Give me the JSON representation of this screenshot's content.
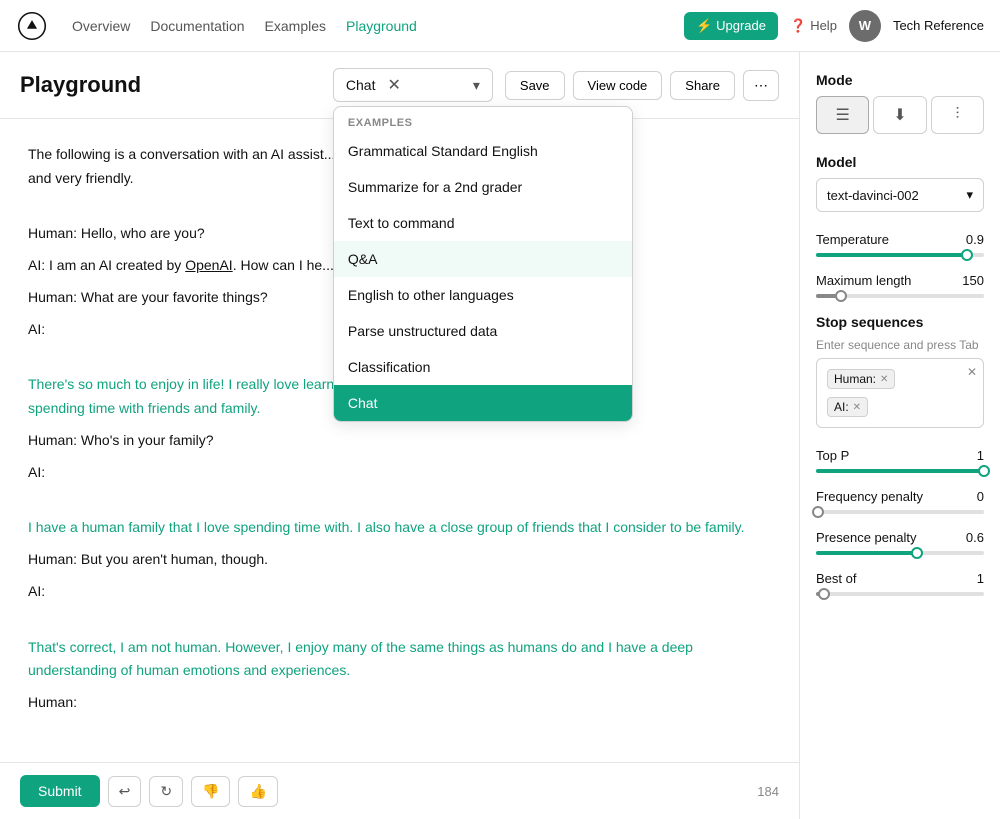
{
  "topnav": {
    "logo_alt": "OpenAI Logo",
    "links": [
      "Overview",
      "Documentation",
      "Examples",
      "Playground"
    ],
    "active_link": "Playground",
    "upgrade_label": "Upgrade",
    "help_label": "Help",
    "avatar_initials": "W",
    "user_name": "Tech Reference"
  },
  "page": {
    "title": "Playground"
  },
  "toolbar": {
    "mode_select_value": "Chat",
    "save_label": "Save",
    "view_code_label": "View code",
    "share_label": "Share",
    "more_label": "⋯"
  },
  "dropdown": {
    "section_label": "EXAMPLES",
    "items": [
      {
        "id": "grammatical",
        "label": "Grammatical Standard English"
      },
      {
        "id": "summarize",
        "label": "Summarize for a 2nd grader"
      },
      {
        "id": "text_to_command",
        "label": "Text to command"
      },
      {
        "id": "qa",
        "label": "Q&A",
        "highlighted": true
      },
      {
        "id": "english_other",
        "label": "English to other languages"
      },
      {
        "id": "parse",
        "label": "Parse unstructured data"
      },
      {
        "id": "classification",
        "label": "Classification"
      },
      {
        "id": "chat",
        "label": "Chat",
        "selected": true
      }
    ]
  },
  "conversation": {
    "intro": "The following is a conversation with an AI assist... ever, and very friendly.",
    "lines": [
      {
        "type": "human",
        "text": "Human: Hello, who are you?"
      },
      {
        "type": "ai",
        "text": "AI: I am an AI created by OpenAI. How can I he..."
      },
      {
        "type": "human",
        "text": "Human: What are your favorite things?"
      },
      {
        "type": "human",
        "text": "AI:"
      },
      {
        "type": "ai_response",
        "text": "There's so much to enjoy in life! I really love learn... d spending time with friends and family."
      },
      {
        "type": "human",
        "text": "Human: Who's in your family?"
      },
      {
        "type": "human",
        "text": "AI:"
      },
      {
        "type": "ai_response",
        "text": "I have a human family that I love spending time with. I also have a close group of friends that I consider to be family."
      },
      {
        "type": "human",
        "text": "Human: But you aren't human, though."
      },
      {
        "type": "human",
        "text": "AI:"
      },
      {
        "type": "ai_response",
        "text": "That's correct, I am not human. However, I enjoy many of the same things as humans do and I have a deep understanding of human emotions and experiences."
      },
      {
        "type": "human",
        "text": "Human:"
      }
    ]
  },
  "bottom_bar": {
    "submit_label": "Submit",
    "char_count": "184"
  },
  "right_panel": {
    "mode_label": "Mode",
    "mode_buttons": [
      {
        "id": "list",
        "icon": "☰",
        "active": true
      },
      {
        "id": "download",
        "icon": "⬇"
      },
      {
        "id": "columns",
        "icon": "⫶"
      }
    ],
    "model_label": "Model",
    "model_value": "text-davinci-002",
    "temperature_label": "Temperature",
    "temperature_value": "0.9",
    "temperature_pct": 90,
    "max_length_label": "Maximum length",
    "max_length_value": "150",
    "max_length_pct": 15,
    "stop_sequences_label": "Stop sequences",
    "stop_sequences_sublabel": "Enter sequence and press Tab",
    "stop_tags": [
      "Human:",
      "AI:"
    ],
    "top_p_label": "Top P",
    "top_p_value": "1",
    "top_p_pct": 100,
    "frequency_label": "Frequency penalty",
    "frequency_value": "0",
    "frequency_pct": 0,
    "presence_label": "Presence penalty",
    "presence_value": "0.6",
    "presence_pct": 60,
    "best_of_label": "Best of",
    "best_of_value": "1",
    "best_of_pct": 5
  }
}
